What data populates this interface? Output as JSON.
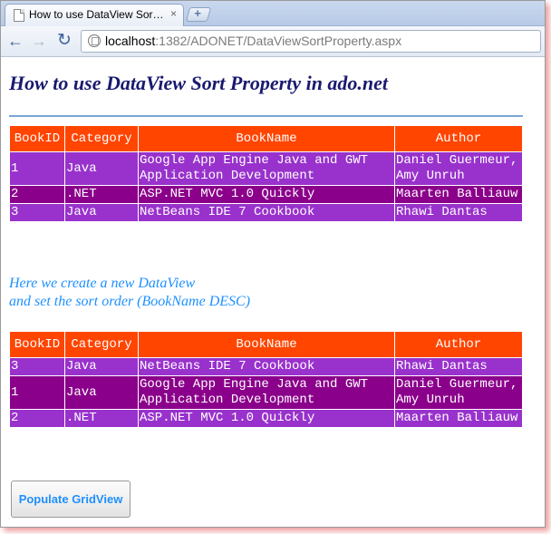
{
  "browser": {
    "tab_title": "How to use DataView Sor…",
    "tab_close": "×",
    "new_tab": "+",
    "url_host": "localhost",
    "url_path": ":1382/ADONET/DataViewSortProperty.aspx",
    "back_icon": "←",
    "forward_icon": "→",
    "reload_icon": "↻"
  },
  "page": {
    "title": "How to use DataView Sort Property in ado.net",
    "note_line1": "Here we create a new DataView",
    "note_line2": "and set the sort order (BookName DESC)",
    "button_label": "Populate GridView"
  },
  "grid1": {
    "headers": [
      "BookID",
      "Category",
      "BookName",
      "Author"
    ],
    "rows": [
      [
        "1",
        "Java",
        "Google App Engine Java and GWT Application Development",
        "Daniel Guermeur, Amy Unruh"
      ],
      [
        "2",
        ".NET",
        "ASP.NET MVC 1.0 Quickly",
        "Maarten Balliauw"
      ],
      [
        "3",
        "Java",
        "NetBeans IDE 7 Cookbook",
        "Rhawi Dantas"
      ]
    ]
  },
  "grid2": {
    "headers": [
      "BookID",
      "Category",
      "BookName",
      "Author"
    ],
    "rows": [
      [
        "3",
        "Java",
        "NetBeans IDE 7 Cookbook",
        "Rhawi Dantas"
      ],
      [
        "1",
        "Java",
        "Google App Engine Java and GWT Application Development",
        "Daniel Guermeur, Amy Unruh"
      ],
      [
        "2",
        ".NET",
        "ASP.NET MVC 1.0 Quickly",
        "Maarten Balliauw"
      ]
    ]
  },
  "colors": {
    "header_bg": "#ff4500",
    "row_light": "#9932cc",
    "row_dark": "#8b008b",
    "title": "#191970",
    "note": "#1e90ff"
  }
}
